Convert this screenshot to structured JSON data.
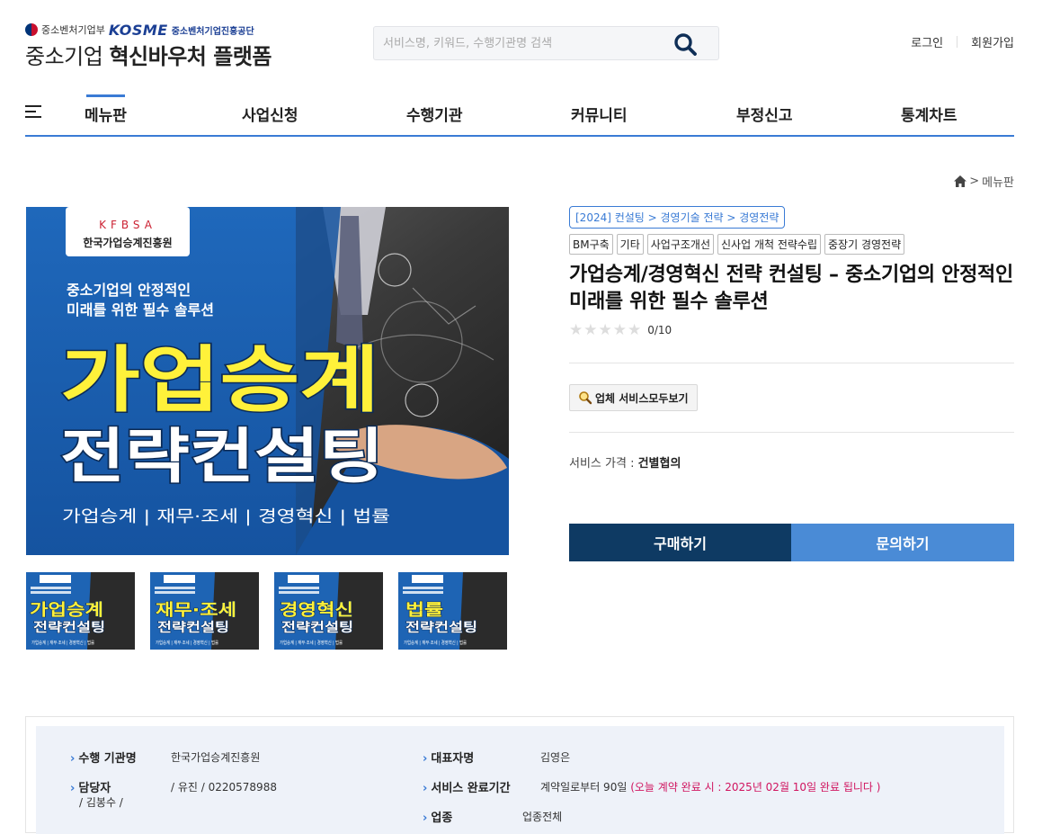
{
  "logo": {
    "ministry": "중소벤처기업부",
    "kosme": "KOSME",
    "agency": "중소벤처기업진흥공단",
    "platform_prefix": "중소기업",
    "platform_bold": "혁신바우처 플랫폼"
  },
  "search": {
    "placeholder": "서비스명, 키워드, 수행기관명 검색",
    "value": ""
  },
  "top_links": {
    "login": "로그인",
    "signup": "회원가입"
  },
  "nav": {
    "items": [
      "메뉴판",
      "사업신청",
      "수행기관",
      "커뮤니티",
      "부정신고",
      "통계차트"
    ],
    "active": "메뉴판"
  },
  "breadcrumb": {
    "sep": ">",
    "current": "메뉴판"
  },
  "product": {
    "image": {
      "org_letters": [
        "K",
        "F",
        "B",
        "S",
        "A"
      ],
      "org_name": "한국가업승계진흥원",
      "sub1": "중소기업의 안정적인",
      "sub2": "미래를 위한 필수 솔루션",
      "headline1": "가업승계",
      "headline2": "전략컨설팅",
      "bottom": "가업승계 | 재무·조세 | 경영혁신 | 법률"
    },
    "thumbnails": [
      {
        "title": "가업승계",
        "subtitle": "전략컨설팅",
        "caption": "가업승계 | 재무·조세 | 경영혁신 | 법률"
      },
      {
        "title": "재무·조세",
        "subtitle": "전략컨설팅",
        "caption": "가업승계 | 재무·조세 | 경영혁신 | 법률"
      },
      {
        "title": "경영혁신",
        "subtitle": "전략컨설팅",
        "caption": "가업승계 | 재무·조세 | 경영혁신 | 법률"
      },
      {
        "title": "법률",
        "subtitle": "전략컨설팅",
        "caption": "가업승계 | 재무·조세 | 경영혁신 | 법률"
      }
    ],
    "category_path": "[2024] 컨설팅 > 경영기술 전략 > 경영전략",
    "tags": [
      "BM구축",
      "기타",
      "사업구조개선",
      "신사업 개척 전략수립",
      "중장기 경영전략"
    ],
    "title": "가업승계/경영혁신 전략 컨설팅 – 중소기업의 안정적인 미래를 위한 필수 솔루션",
    "rating": {
      "stars": "★★★★★",
      "value": 0,
      "max": 10,
      "text": "0/10"
    },
    "vendor_button": "업체 서비스모두보기",
    "price_label": "서비스 가격 : ",
    "price_value": "건별협의",
    "buy_button": "구매하기",
    "ask_button": "문의하기"
  },
  "details": {
    "org_label": "수행 기관명",
    "org_value": "한국가업승계진흥원",
    "ceo_label": "대표자명",
    "ceo_value": "김영은",
    "contact_label": "담당자",
    "contact_name2": "/ 김봉수 /",
    "contact_value": "/ 유진 / 0220578988",
    "period_label": "서비스 완료기간",
    "period_value": "계약일로부터 90일",
    "period_note": "(오늘 계약 완료 시 : 2025년 02월 10일 완료 됩니다 )",
    "industry_label": "업종",
    "industry_value": "업종전체"
  },
  "colors": {
    "accent": "#3a7bd5",
    "buy": "#0e3a63",
    "ask": "#4a8bd6",
    "banner": "#1e64b4",
    "headline_yellow": "#fff13a",
    "note": "#d0145f"
  }
}
